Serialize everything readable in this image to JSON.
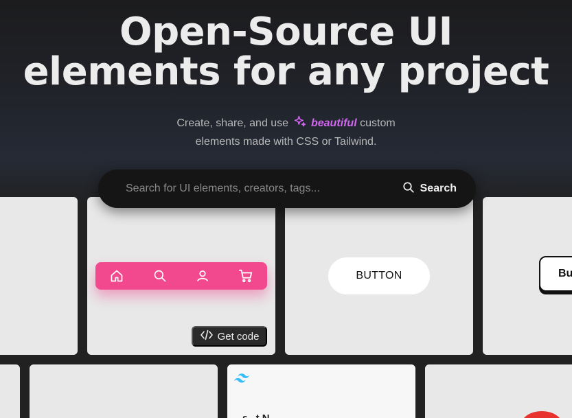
{
  "hero": {
    "title_line1": "Open-Source UI",
    "title_line2": "elements for any project",
    "subtitle_before": "Create, share, and use",
    "subtitle_accent": "beautiful",
    "subtitle_after": "custom",
    "subtitle_line2": "elements made with CSS or Tailwind."
  },
  "search": {
    "placeholder": "Search for UI elements, creators, tags...",
    "button_label": "Search"
  },
  "cards": {
    "navbar_card": {
      "get_code_label": "Get code"
    },
    "button_card": {
      "label": "BUTTON"
    },
    "outline_card": {
      "label": "Bu"
    },
    "tailwind_card": {
      "text": "ε...t N..."
    }
  },
  "colors": {
    "accent": "#d166f0",
    "navbar_pink": "#f2498e",
    "tailwind_blue": "#38bdf8",
    "red": "#e8322e"
  },
  "icons": {
    "sparkle": "sparkle-icon",
    "search": "search-icon",
    "home": "home-icon",
    "user": "user-icon",
    "cart": "cart-icon",
    "code": "code-icon",
    "tailwind": "tailwind-logo-icon"
  }
}
